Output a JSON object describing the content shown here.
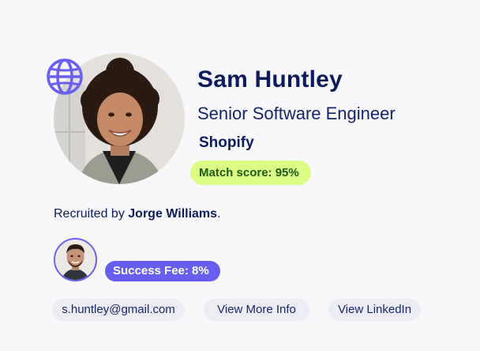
{
  "profile": {
    "name": "Sam Huntley",
    "title": "Senior Software Engineer",
    "company": "Shopify",
    "match_label": "Match score: 95%",
    "match_score": 95
  },
  "recruiter": {
    "prefix": "Recruited by ",
    "name": "Jorge Williams",
    "suffix": ".",
    "fee_label": "Success Fee: 8%"
  },
  "actions": {
    "email": "s.huntley@gmail.com",
    "more_info": "View More Info",
    "linkedin": "View LinkedIn"
  },
  "icons": {
    "globe": "globe-icon"
  },
  "colors": {
    "primary_text": "#0d1b5e",
    "accent": "#675ef0",
    "match_bg": "#dcfb85",
    "match_text": "#1d5a14",
    "chip_bg": "#ececf5"
  }
}
